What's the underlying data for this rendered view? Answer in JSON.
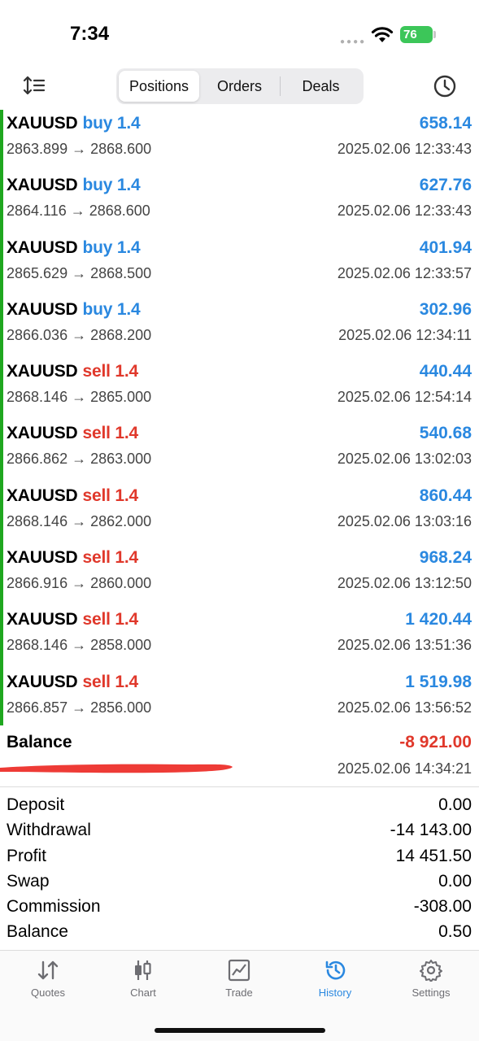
{
  "status": {
    "time": "7:34",
    "battery": "76"
  },
  "header": {
    "tabs": [
      {
        "label": "Positions",
        "active": true
      },
      {
        "label": "Orders",
        "active": false
      },
      {
        "label": "Deals",
        "active": false
      }
    ]
  },
  "deals": [
    {
      "symbol": "XAUUSD",
      "side": "buy 1.4",
      "type": "buy",
      "prices": "2863.899 → 2868.600",
      "profit": "658.14",
      "date": "2025.02.06 12:33:43"
    },
    {
      "symbol": "XAUUSD",
      "side": "buy 1.4",
      "type": "buy",
      "prices": "2864.116 → 2868.600",
      "profit": "627.76",
      "date": "2025.02.06 12:33:43"
    },
    {
      "symbol": "XAUUSD",
      "side": "buy 1.4",
      "type": "buy",
      "prices": "2865.629 → 2868.500",
      "profit": "401.94",
      "date": "2025.02.06 12:33:57"
    },
    {
      "symbol": "XAUUSD",
      "side": "buy 1.4",
      "type": "buy",
      "prices": "2866.036 → 2868.200",
      "profit": "302.96",
      "date": "2025.02.06 12:34:11"
    },
    {
      "symbol": "XAUUSD",
      "side": "sell 1.4",
      "type": "sell",
      "prices": "2868.146 → 2865.000",
      "profit": "440.44",
      "date": "2025.02.06 12:54:14"
    },
    {
      "symbol": "XAUUSD",
      "side": "sell 1.4",
      "type": "sell",
      "prices": "2866.862 → 2863.000",
      "profit": "540.68",
      "date": "2025.02.06 13:02:03"
    },
    {
      "symbol": "XAUUSD",
      "side": "sell 1.4",
      "type": "sell",
      "prices": "2868.146 → 2862.000",
      "profit": "860.44",
      "date": "2025.02.06 13:03:16"
    },
    {
      "symbol": "XAUUSD",
      "side": "sell 1.4",
      "type": "sell",
      "prices": "2866.916 → 2860.000",
      "profit": "968.24",
      "date": "2025.02.06 13:12:50"
    },
    {
      "symbol": "XAUUSD",
      "side": "sell 1.4",
      "type": "sell",
      "prices": "2868.146 → 2858.000",
      "profit": "1 420.44",
      "date": "2025.02.06 13:51:36"
    },
    {
      "symbol": "XAUUSD",
      "side": "sell 1.4",
      "type": "sell",
      "prices": "2866.857 → 2856.000",
      "profit": "1 519.98",
      "date": "2025.02.06 13:56:52"
    }
  ],
  "balance_entry": {
    "label": "Balance",
    "value": "-8 921.00",
    "date": "2025.02.06 14:34:21"
  },
  "summary": [
    {
      "label": "Deposit",
      "value": "0.00"
    },
    {
      "label": "Withdrawal",
      "value": "-14 143.00"
    },
    {
      "label": "Profit",
      "value": "14 451.50"
    },
    {
      "label": "Swap",
      "value": "0.00"
    },
    {
      "label": "Commission",
      "value": "-308.00"
    },
    {
      "label": "Balance",
      "value": "0.50"
    }
  ],
  "tabbar": [
    {
      "label": "Quotes",
      "icon": "quotes-icon",
      "active": false
    },
    {
      "label": "Chart",
      "icon": "chart-icon",
      "active": false
    },
    {
      "label": "Trade",
      "icon": "trade-icon",
      "active": false
    },
    {
      "label": "History",
      "icon": "history-icon",
      "active": true
    },
    {
      "label": "Settings",
      "icon": "settings-icon",
      "active": false
    }
  ],
  "colors": {
    "accent": "#2a88e0",
    "sell": "#e0382b",
    "green_bar": "#1fa71f",
    "battery": "#3cc659"
  }
}
